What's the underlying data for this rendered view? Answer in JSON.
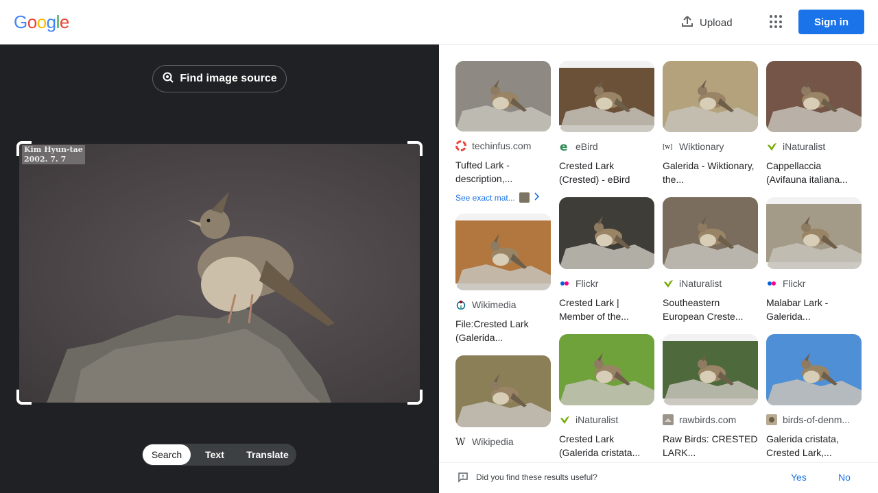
{
  "header": {
    "logo_letters": [
      "G",
      "o",
      "o",
      "g",
      "l",
      "e"
    ],
    "logo_colors": [
      "#4285F4",
      "#EA4335",
      "#FBBC05",
      "#4285F4",
      "#34A853",
      "#EA4335"
    ],
    "upload_label": "Upload",
    "apps_icon": "apps-grid-icon",
    "signin_label": "Sign in"
  },
  "lens": {
    "find_source_label": "Find image source",
    "watermark_line1": "Kim Hyun-tae",
    "watermark_line2": "2002. 7. 7",
    "modes": [
      "Search",
      "Text",
      "Translate"
    ],
    "active_mode": "Search"
  },
  "results": {
    "columns": [
      [
        {
          "source": "techinfus.com",
          "favicon": "lifebuoy-icon",
          "title": "Tufted Lark - description,...",
          "exact_match": "See exact mat...",
          "thumb_h": 103,
          "bg": "#8e8a83"
        },
        {
          "source": "Wikimedia",
          "favicon": "wikimedia-icon",
          "title": "File:Crested Lark (Galerida...",
          "thumb_h": 112,
          "bg": "#b2773f"
        },
        {
          "source": "Wikipedia",
          "favicon": "wikipedia-icon",
          "title": "",
          "thumb_h": 105,
          "bg": "#8a7f56"
        }
      ],
      [
        {
          "source": "eBird",
          "favicon": "ebird-icon",
          "title": "Crested Lark (Crested) - eBird",
          "thumb_h": 104,
          "bg": "#6b5137"
        },
        {
          "source": "Flickr",
          "favicon": "flickr-icon",
          "title": "Crested Lark | Member of the...",
          "thumb_h": 105,
          "bg": "#3f3d38"
        },
        {
          "source": "iNaturalist",
          "favicon": "inaturalist-icon",
          "title": "Crested Lark (Galerida cristata...",
          "thumb_h": 104,
          "bg": "#6fa23a"
        }
      ],
      [
        {
          "source": "Wiktionary",
          "favicon": "wiktionary-icon",
          "title": "Galerida - Wiktionary, the...",
          "thumb_h": 104,
          "bg": "#b4a27c"
        },
        {
          "source": "iNaturalist",
          "favicon": "inaturalist-icon",
          "title": "Southeastern European Creste...",
          "thumb_h": 105,
          "bg": "#7b6d5d"
        },
        {
          "source": "rawbirds.com",
          "favicon": "rawbirds-icon",
          "title": "Raw Birds: CRESTED LARK...",
          "thumb_h": 104,
          "bg": "#4e6a3c"
        }
      ],
      [
        {
          "source": "iNaturalist",
          "favicon": "inaturalist-icon",
          "title": "Cappellaccia (Avifauna italiana...",
          "thumb_h": 104,
          "bg": "#745547"
        },
        {
          "source": "Flickr",
          "favicon": "flickr-icon",
          "title": "Malabar Lark - Galerida...",
          "thumb_h": 105,
          "bg": "#a49a88"
        },
        {
          "source": "birds-of-denm...",
          "favicon": "birds-of-denmark-icon",
          "title": "Galerida cristata, Crested Lark,...",
          "thumb_h": 104,
          "bg": "#4f8fd6"
        }
      ]
    ]
  },
  "feedback": {
    "question": "Did you find these results useful?",
    "yes_label": "Yes",
    "no_label": "No"
  }
}
